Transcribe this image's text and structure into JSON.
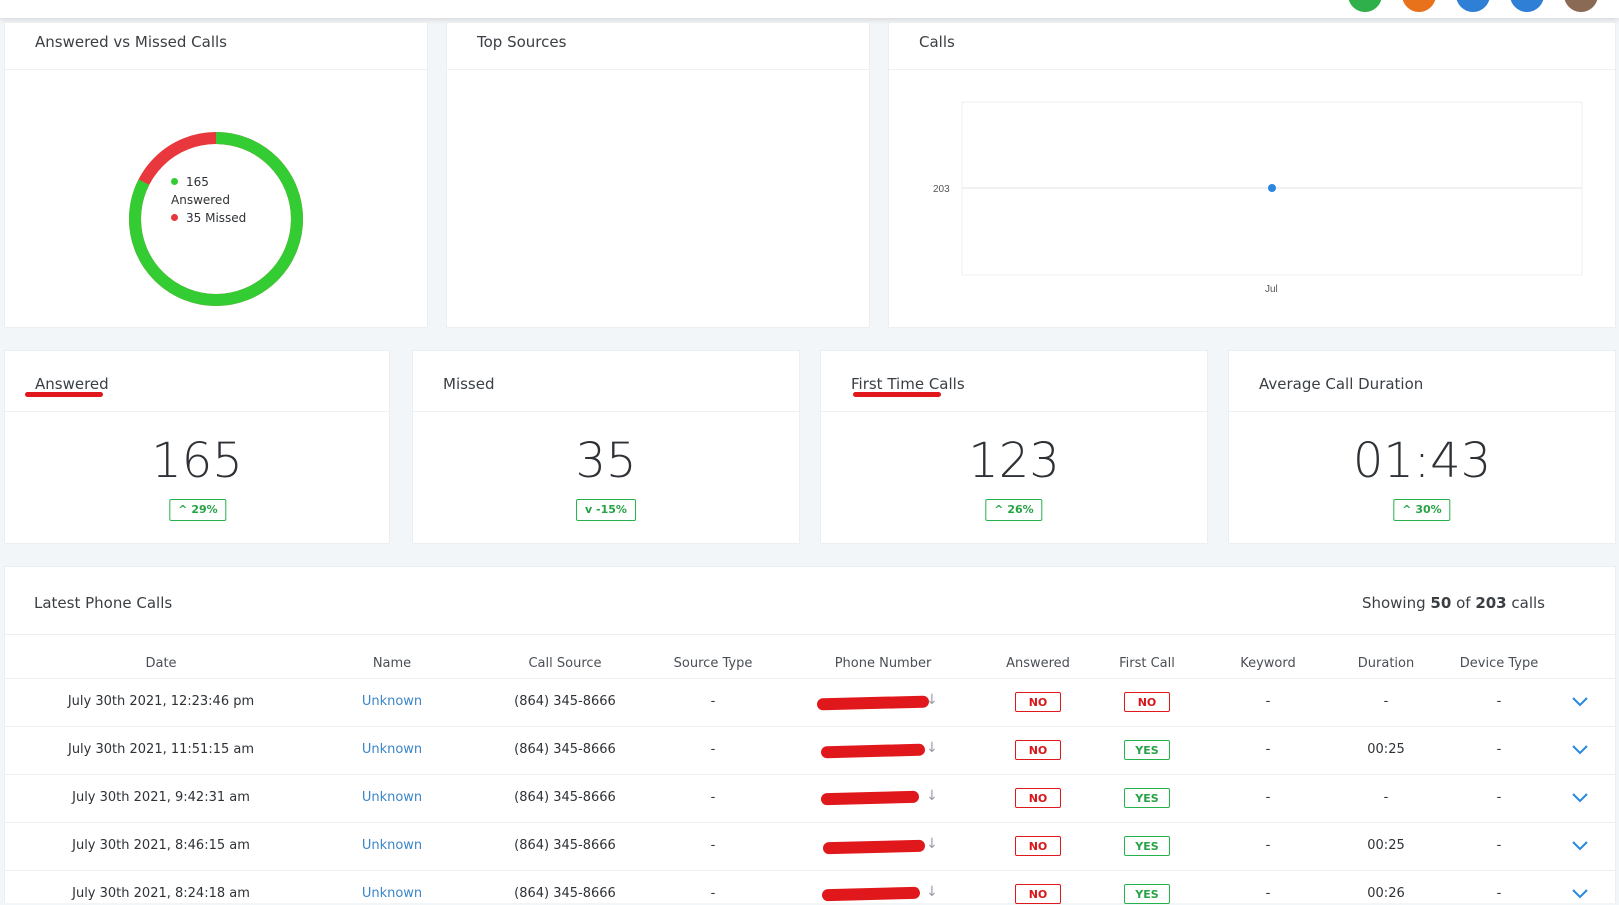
{
  "colors": {
    "answered": "#33cc33",
    "missed": "#e8383d",
    "accent": "#3a86c8",
    "badge_green": "#26a345",
    "badge_red": "#d81519"
  },
  "donut": {
    "title": "Answered vs Missed Calls",
    "answered_value": "165",
    "answered_label": "Answered",
    "missed_text": "35 Missed",
    "answered": 165,
    "missed": 35
  },
  "top_sources": {
    "title": "Top Sources"
  },
  "calls_chart": {
    "title": "Calls",
    "chart_data": {
      "type": "line",
      "x": [
        "Jul"
      ],
      "series": [
        {
          "values": [
            203
          ]
        }
      ],
      "yticks": [
        "203"
      ],
      "xticks": [
        "Jul"
      ],
      "grid": true
    }
  },
  "stats": [
    {
      "title": "Answered",
      "value": "165",
      "change": "29%",
      "direction": "up"
    },
    {
      "title": "Missed",
      "value": "35",
      "change": "-15%",
      "direction": "down"
    },
    {
      "title": "First Time Calls",
      "value": "123",
      "change": "26%",
      "direction": "up"
    },
    {
      "title": "Average Call Duration",
      "value": "01:43",
      "change": "30%",
      "direction": "up"
    }
  ],
  "table": {
    "title": "Latest Phone Calls",
    "showing_prefix": "Showing",
    "showing_count": "50",
    "showing_of": "of",
    "showing_total": "203",
    "showing_suffix": "calls",
    "columns": [
      "Date",
      "Name",
      "Call Source",
      "Source Type",
      "Phone Number",
      "Answered",
      "First Call",
      "Keyword",
      "Duration",
      "Device Type"
    ],
    "rows": [
      {
        "date": "July 30th 2021, 12:23:46 pm",
        "name": "Unknown",
        "source": "(864) 345-8666",
        "source_type": "-",
        "answered": "NO",
        "first_call": "NO",
        "keyword": "-",
        "duration": "-",
        "device": "-"
      },
      {
        "date": "July 30th 2021, 11:51:15 am",
        "name": "Unknown",
        "source": "(864) 345-8666",
        "source_type": "-",
        "answered": "NO",
        "first_call": "YES",
        "keyword": "-",
        "duration": "00:25",
        "device": "-"
      },
      {
        "date": "July 30th 2021, 9:42:31 am",
        "name": "Unknown",
        "source": "(864) 345-8666",
        "source_type": "-",
        "answered": "NO",
        "first_call": "YES",
        "keyword": "-",
        "duration": "-",
        "device": "-"
      },
      {
        "date": "July 30th 2021, 8:46:15 am",
        "name": "Unknown",
        "source": "(864) 345-8666",
        "source_type": "-",
        "answered": "NO",
        "first_call": "YES",
        "keyword": "-",
        "duration": "00:25",
        "device": "-"
      },
      {
        "date": "July 30th 2021, 8:24:18 am",
        "name": "Unknown",
        "source": "(864) 345-8666",
        "source_type": "-",
        "answered": "NO",
        "first_call": "YES",
        "keyword": "-",
        "duration": "00:26",
        "device": "-"
      }
    ]
  }
}
